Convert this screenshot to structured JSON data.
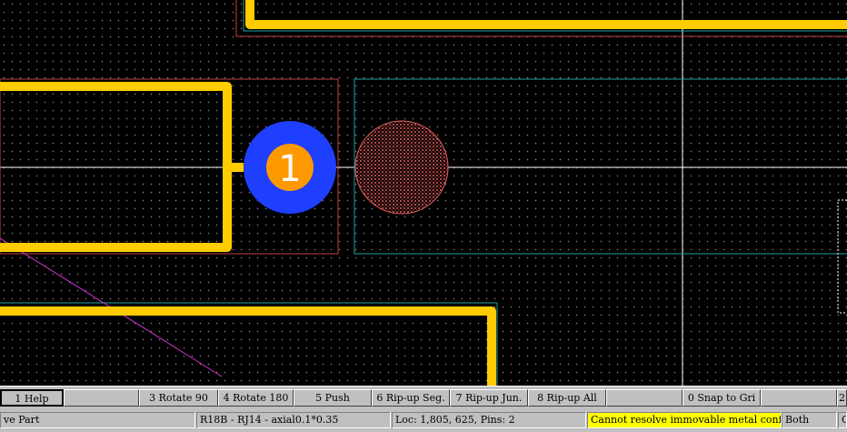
{
  "function_keys": [
    {
      "label": "1 Help"
    },
    {
      "label": ""
    },
    {
      "label": "3 Rotate 90"
    },
    {
      "label": "4 Rotate 180"
    },
    {
      "label": "5 Push"
    },
    {
      "label": "6 Rip-up Seg."
    },
    {
      "label": "7 Rip-up Jun."
    },
    {
      "label": "8 Rip-up All"
    },
    {
      "label": ""
    },
    {
      "label": "0 Snap to Gri"
    },
    {
      "label": ""
    },
    {
      "label": "2"
    }
  ],
  "status": {
    "mode": "ve Part",
    "component": "R18B - RJ14 - axial0.1*0.35",
    "location": "Loc: 1,805, 625, Pins: 2",
    "message": "Cannot resolve immovable metal conf",
    "layer": "Both",
    "extra": "G"
  },
  "pads": [
    {
      "number": "1"
    }
  ],
  "colors": {
    "trace": "#ffcc00",
    "pad_ring": "#1f3fff",
    "pad_center": "#ff9900",
    "outline_red": "#c04040",
    "outline_cyan": "#20a0a0",
    "ratsnest": "#cc33cc",
    "crosshair": "#ffffff",
    "warning_bg": "#ffff00"
  }
}
